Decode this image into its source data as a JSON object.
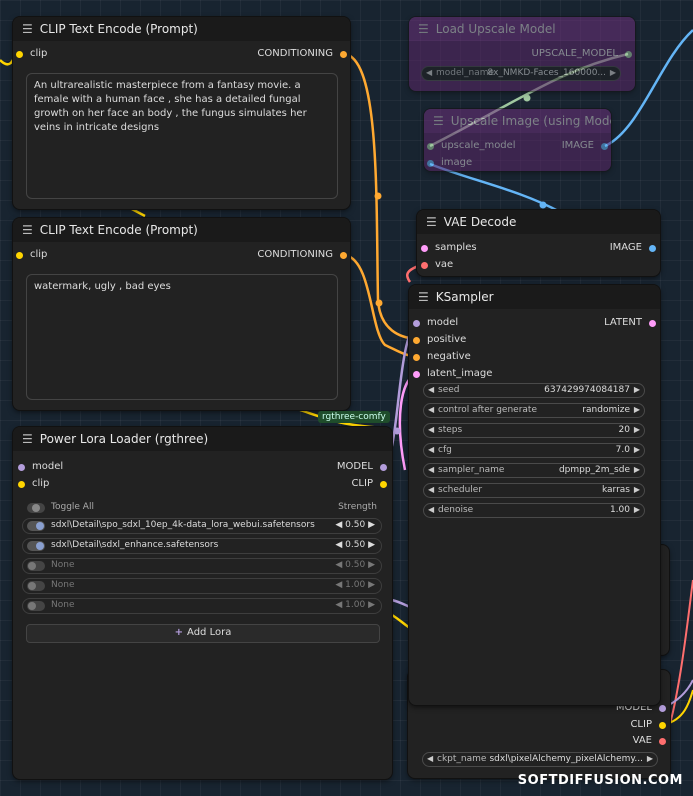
{
  "clip1": {
    "title": "CLIP Text Encode (Prompt)",
    "input_clip": "clip",
    "output": "CONDITIONING",
    "text": "An ultrarealistic masterpiece from a fantasy movie. a female with a human face , she has a detailed fungal growth on her face an body , the fungus simulates her veins in intricate designs"
  },
  "clip2": {
    "title": "CLIP Text Encode (Prompt)",
    "input_clip": "clip",
    "output": "CONDITIONING",
    "text": "watermark, ugly , bad eyes"
  },
  "load_upscale": {
    "title": "Load Upscale Model",
    "output": "UPSCALE_MODEL",
    "widget_label": "model_name",
    "widget_value": "8x_NMKD-Faces_160000..."
  },
  "upscale_image": {
    "title": "Upscale Image (using Model)",
    "input1": "upscale_model",
    "input2": "image",
    "output": "IMAGE"
  },
  "vae_decode": {
    "title": "VAE Decode",
    "input1": "samples",
    "input2": "vae",
    "output": "IMAGE"
  },
  "ksampler": {
    "title": "KSampler",
    "inputs": [
      "model",
      "positive",
      "negative",
      "latent_image"
    ],
    "output": "LATENT",
    "widgets": [
      {
        "label": "seed",
        "value": "637429974084187"
      },
      {
        "label": "control after generate",
        "value": "randomize"
      },
      {
        "label": "steps",
        "value": "20"
      },
      {
        "label": "cfg",
        "value": "7.0"
      },
      {
        "label": "sampler_name",
        "value": "dpmpp_2m_sde"
      },
      {
        "label": "scheduler",
        "value": "karras"
      },
      {
        "label": "denoise",
        "value": "1.00"
      }
    ]
  },
  "lora": {
    "badge": "rgthree-comfy",
    "title": "Power Lora Loader (rgthree)",
    "input1": "model",
    "input2": "clip",
    "output1": "MODEL",
    "output2": "CLIP",
    "toggle_all": "Toggle All",
    "strength_header": "Strength",
    "rows": [
      {
        "name": "sdxl\\Detail\\spo_sdxl_10ep_4k-data_lora_webui.safetensors",
        "strength": "0.50",
        "on": true
      },
      {
        "name": "sdxl\\Detail\\sdxl_enhance.safetensors",
        "strength": "0.50",
        "on": true
      },
      {
        "name": "None",
        "strength": "0.50",
        "on": false
      },
      {
        "name": "None",
        "strength": "1.00",
        "on": false
      },
      {
        "name": "None",
        "strength": "1.00",
        "on": false
      }
    ],
    "add_label": "Add Lora",
    "add_icon": "+"
  },
  "checkpoint": {
    "out1": "MODEL",
    "out2": "CLIP",
    "out3": "VAE",
    "widget_label": "ckpt_name",
    "widget_value": "sdxl\\pixelAlchemy_pixelAlchemy..."
  },
  "watermark": "SOFTDIFFUSION.COM",
  "colors": {
    "clip": "#ffd500",
    "conditioning": "#ffa931",
    "model": "#b39ddb",
    "latent": "#ff9cf9",
    "image": "#64b5f6",
    "vae": "#ff6e6e",
    "upscale_model": "#a0c8a0"
  }
}
